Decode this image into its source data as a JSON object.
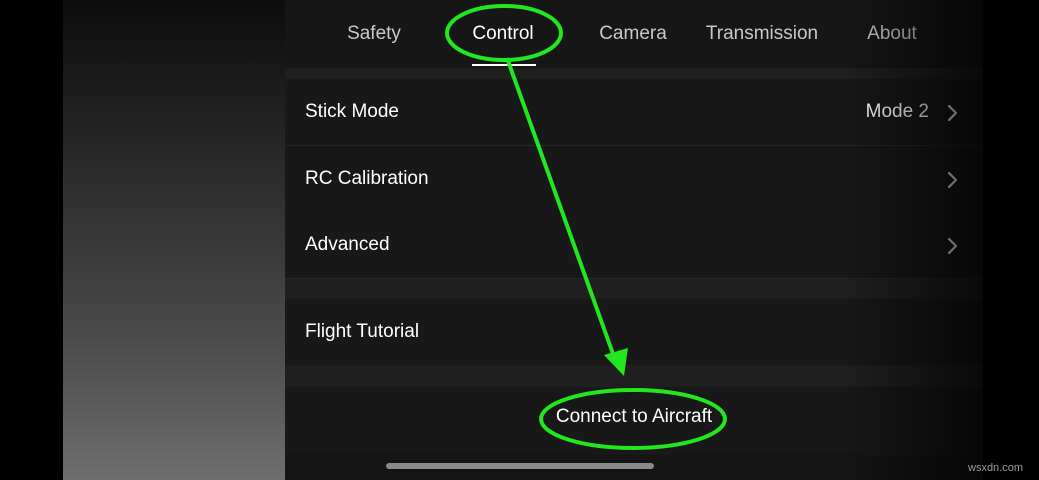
{
  "tabs": [
    {
      "label": "Safety",
      "active": false
    },
    {
      "label": "Control",
      "active": true
    },
    {
      "label": "Camera",
      "active": false
    },
    {
      "label": "Transmission",
      "active": false
    },
    {
      "label": "About",
      "active": false
    }
  ],
  "rows": {
    "stick_mode": {
      "label": "Stick Mode",
      "value": "Mode 2"
    },
    "rc_calibration": {
      "label": "RC Calibration"
    },
    "advanced": {
      "label": "Advanced"
    },
    "flight_tutorial": {
      "label": "Flight Tutorial"
    }
  },
  "connect": {
    "label": "Connect to Aircraft"
  },
  "annotation": {
    "color": "#22e61e"
  },
  "watermark": "wsxdn.com",
  "icons": {
    "chevron": "chevron-right-icon"
  }
}
